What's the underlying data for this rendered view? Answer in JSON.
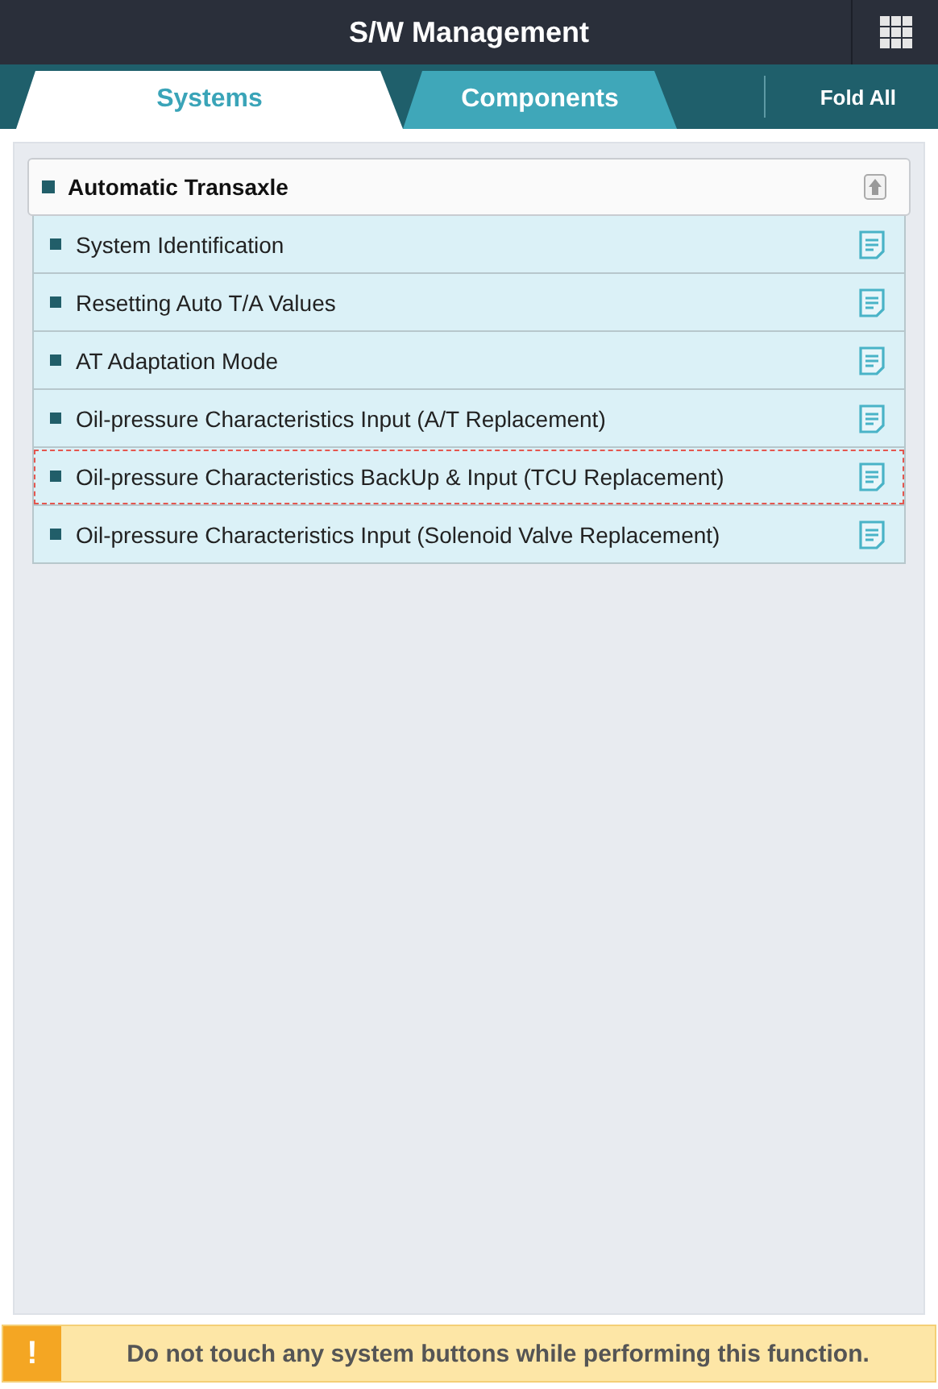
{
  "header": {
    "title": "S/W Management"
  },
  "tabs": [
    {
      "label": "Systems",
      "selected": true
    },
    {
      "label": "Components",
      "selected": false
    }
  ],
  "fold_button": "Fold All",
  "group": {
    "title": "Automatic Transaxle",
    "expanded": true,
    "items": [
      {
        "label": "System Identification",
        "selected": false
      },
      {
        "label": "Resetting Auto T/A Values",
        "selected": false
      },
      {
        "label": "AT Adaptation Mode",
        "selected": false
      },
      {
        "label": "Oil-pressure Characteristics Input (A/T Replacement)",
        "selected": false
      },
      {
        "label": "Oil-pressure Characteristics BackUp & Input (TCU Replacement)",
        "selected": true
      },
      {
        "label": "Oil-pressure Characteristics Input (Solenoid Valve Replacement)",
        "selected": false
      }
    ]
  },
  "warning": {
    "mark": "!",
    "text": "Do not touch any system buttons while performing this function."
  }
}
